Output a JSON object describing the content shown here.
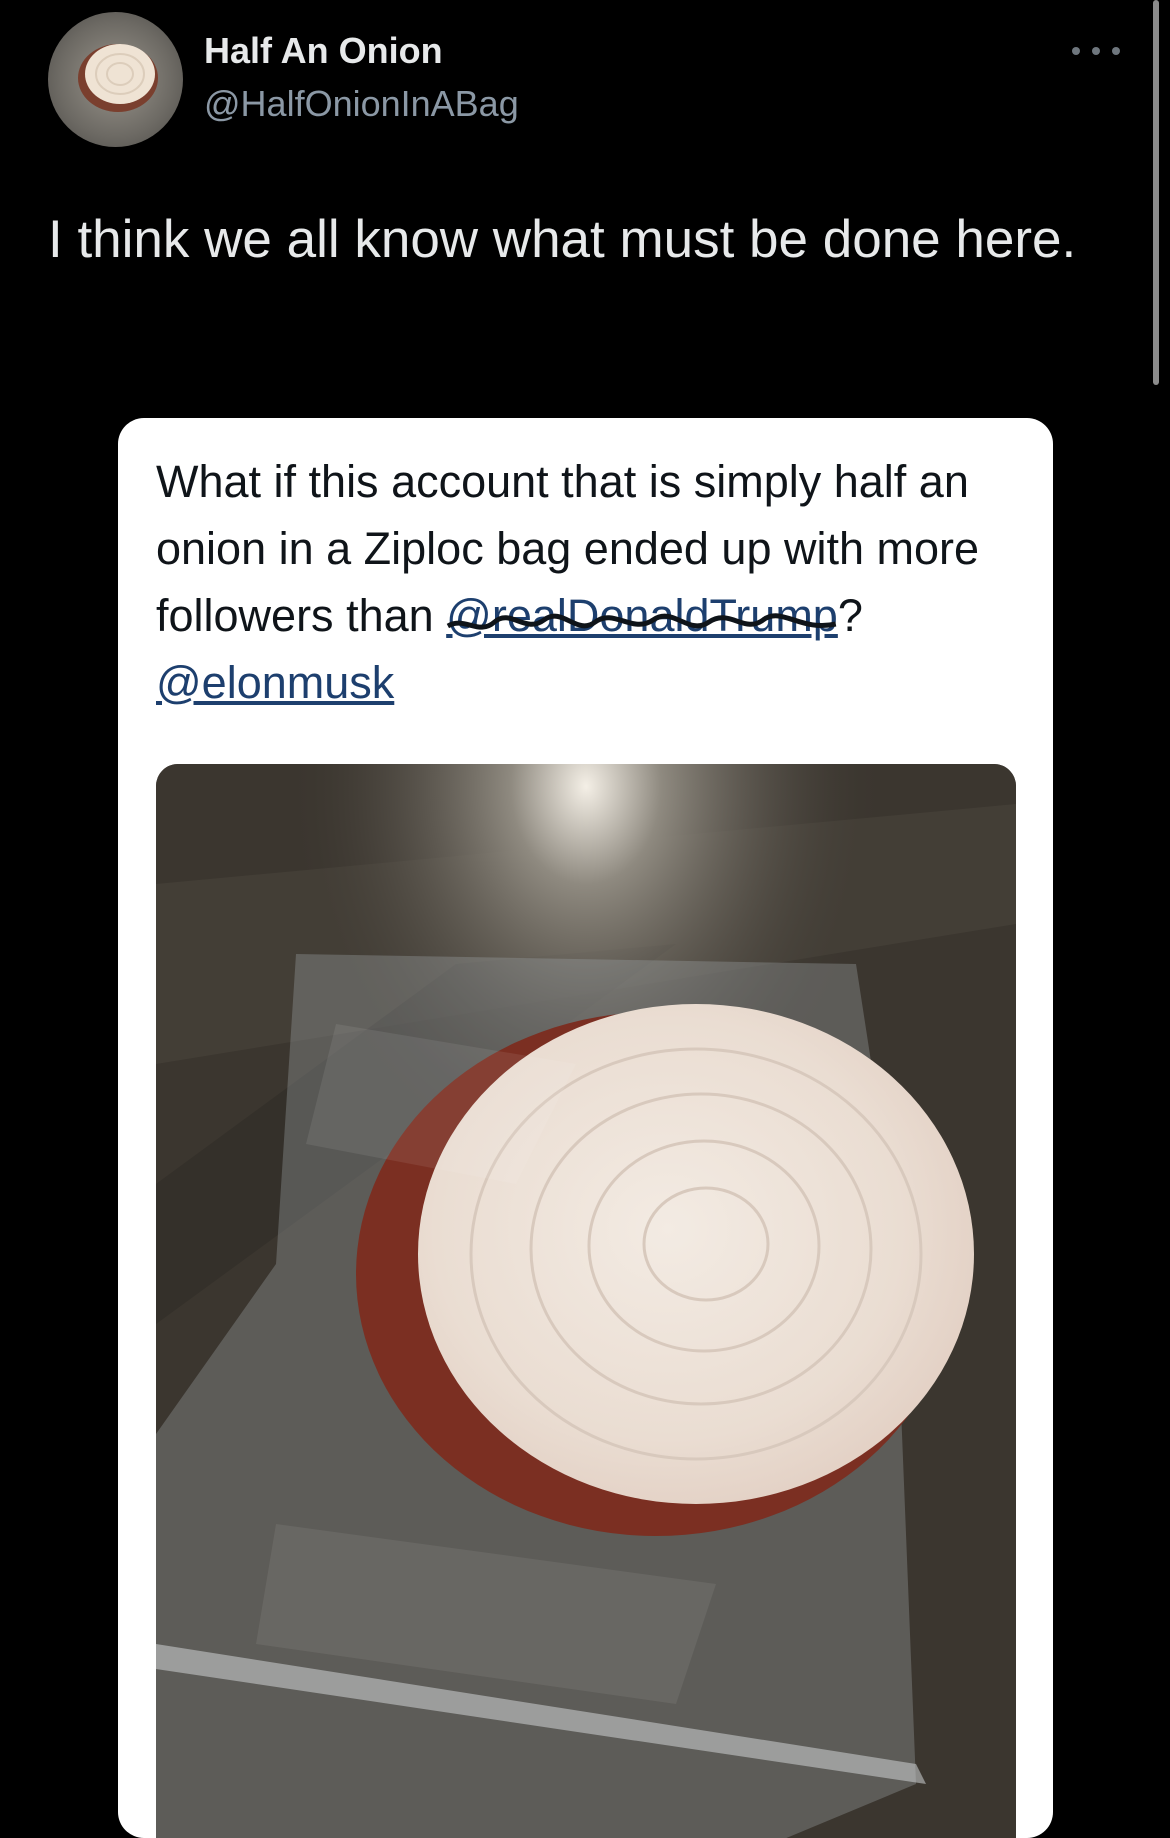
{
  "author": {
    "display_name": "Half An Onion",
    "handle": "@HalfOnionInABag"
  },
  "tweet": {
    "text": "I think we all know what must be done here."
  },
  "quoted_tweet": {
    "text": "What if this account that is simply half an onion in a Ziploc bag ended up with more followers than",
    "mention_redacted": "@realDonaldTrump",
    "separator": "?",
    "mention": "@elonmusk"
  },
  "icons": {
    "more": "more-horizontal-icon"
  },
  "colors": {
    "background": "#000000",
    "primary_text": "#e7e9ea",
    "secondary_text": "#8b98a5",
    "card_background": "#ffffff",
    "mention": "#1d3f6e"
  }
}
